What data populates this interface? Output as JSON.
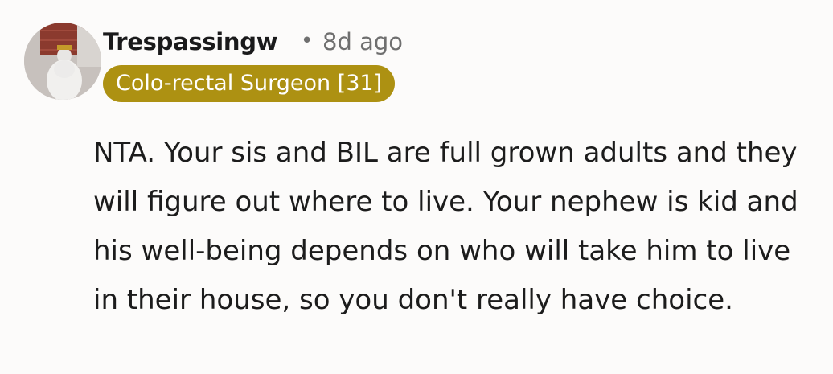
{
  "comment": {
    "author": "Trespassingw",
    "separator": "•",
    "age": "8d ago",
    "flair": "Colo-rectal Surgeon [31]",
    "flair_color": "#ad9112",
    "avatar_icon": "user-avatar-icon",
    "text": "NTA. Your sis and BIL are full grown adults and they will figure out where to live. Your nephew is kid and his well-being depends on who will take him to live in their house, so you don't really have choice."
  }
}
